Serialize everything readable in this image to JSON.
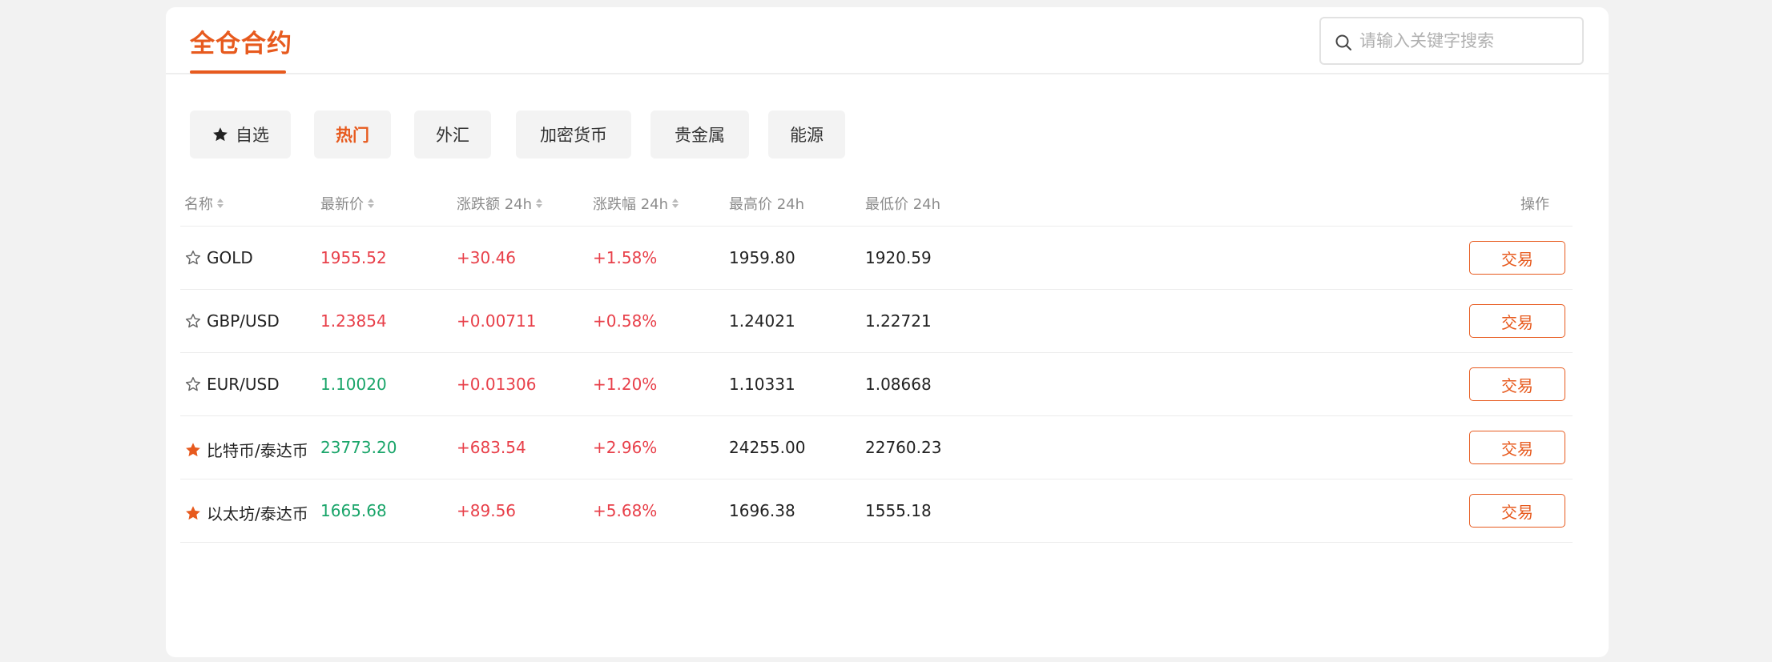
{
  "header": {
    "title": "全仓合约",
    "search_placeholder": "请输入关键字搜索",
    "search_value": ""
  },
  "tabs": [
    {
      "label": "自选",
      "icon": "star-filled-icon",
      "active": false
    },
    {
      "label": "热门",
      "active": true
    },
    {
      "label": "外汇",
      "active": false
    },
    {
      "label": "加密货币",
      "active": false
    },
    {
      "label": "贵金属",
      "active": false
    },
    {
      "label": "能源",
      "active": false
    }
  ],
  "table": {
    "columns": {
      "name": "名称",
      "last_price": "最新价",
      "change_24h": "涨跌额 24h",
      "change_pct_24h": "涨跌幅 24h",
      "high_24h": "最高价 24h",
      "low_24h": "最低价 24h",
      "action": "操作"
    },
    "rows": [
      {
        "favorite": false,
        "name": "GOLD",
        "last_price": "1955.52",
        "price_trend": "up",
        "change": "+30.46",
        "change_pct": "+1.58%",
        "high": "1959.80",
        "low": "1920.59",
        "action": "交易"
      },
      {
        "favorite": false,
        "name": "GBP/USD",
        "last_price": "1.23854",
        "price_trend": "up",
        "change": "+0.00711",
        "change_pct": "+0.58%",
        "high": "1.24021",
        "low": "1.22721",
        "action": "交易"
      },
      {
        "favorite": false,
        "name": "EUR/USD",
        "last_price": "1.10020",
        "price_trend": "down",
        "change": "+0.01306",
        "change_pct": "+1.20%",
        "high": "1.10331",
        "low": "1.08668",
        "action": "交易"
      },
      {
        "favorite": true,
        "name": "比特币/泰达币",
        "last_price": "23773.20",
        "price_trend": "down",
        "change": "+683.54",
        "change_pct": "+2.96%",
        "high": "24255.00",
        "low": "22760.23",
        "action": "交易"
      },
      {
        "favorite": true,
        "name": "以太坊/泰达币",
        "last_price": "1665.68",
        "price_trend": "down",
        "change": "+89.56",
        "change_pct": "+5.68%",
        "high": "1696.38",
        "low": "1555.18",
        "action": "交易"
      }
    ]
  },
  "colors": {
    "accent": "#e75a1e",
    "up": "#e8404a",
    "down": "#1aa56a",
    "chip_bg": "#f3f3f3",
    "page_bg": "#f2f2f2"
  }
}
